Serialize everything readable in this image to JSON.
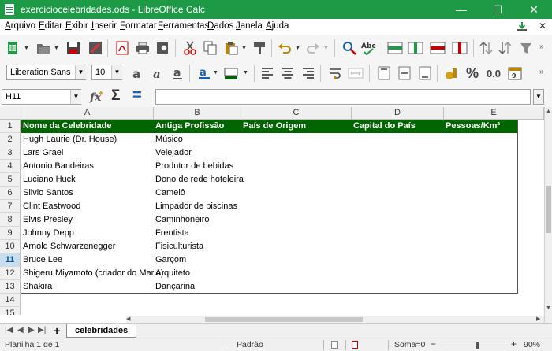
{
  "window": {
    "title": "exerciciocelebridades.ods - LibreOffice Calc",
    "minimize": "—",
    "maximize": "☐",
    "close": "✕",
    "accent": "#1e9a47"
  },
  "menu": [
    "Arquivo",
    "Editar",
    "Exibir",
    "Inserir",
    "Formatar",
    "Ferramentas",
    "Dados",
    "Janela",
    "Ajuda"
  ],
  "toolbar": {
    "font_name": "Liberation Sans",
    "font_size": "10",
    "percent_label": "%",
    "decimal_label": "0.0"
  },
  "formula_bar": {
    "cell_ref": "H11",
    "sum_symbol": "Σ",
    "equals_symbol": "=",
    "value": ""
  },
  "grid": {
    "columns": [
      "A",
      "B",
      "C",
      "D",
      "E"
    ],
    "rows": [
      "1",
      "2",
      "3",
      "4",
      "5",
      "6",
      "7",
      "8",
      "9",
      "10",
      "11",
      "12",
      "13",
      "14",
      "15"
    ],
    "selected_row": "11",
    "header_row": [
      "Nome da Celebridade",
      "Antiga Profissão",
      "País de Origem",
      "Capital do País",
      "Pessoas/Km²"
    ],
    "header_color": "#006400",
    "data": [
      [
        "Hugh Laurie (Dr. House)",
        "Músico"
      ],
      [
        "Lars Grael",
        "Velejador"
      ],
      [
        "Antonio Bandeiras",
        "Produtor de bebidas"
      ],
      [
        "Luciano Huck",
        "Dono de rede hoteleira"
      ],
      [
        "Silvio Santos",
        "Camelô"
      ],
      [
        "Clint Eastwood",
        "Limpador de piscinas"
      ],
      [
        "Elvis Presley",
        "Caminhoneiro"
      ],
      [
        "Johnny Depp",
        "Frentista"
      ],
      [
        "Arnold Schwarzenegger",
        "Fisiculturista"
      ],
      [
        "Bruce Lee",
        "Garçom"
      ],
      [
        "Shigeru Miyamoto (criador do Mario)",
        "Arquiteto"
      ],
      [
        "Shakira",
        "Dançarina"
      ]
    ]
  },
  "sheets": {
    "add": "+",
    "active_tab": "celebridades"
  },
  "status": {
    "sheet_info": "Planilha 1 de 1",
    "style": "Padrão",
    "sum": "Soma=0",
    "zoom_minus": "−",
    "zoom_plus": "+",
    "zoom": "90%"
  }
}
